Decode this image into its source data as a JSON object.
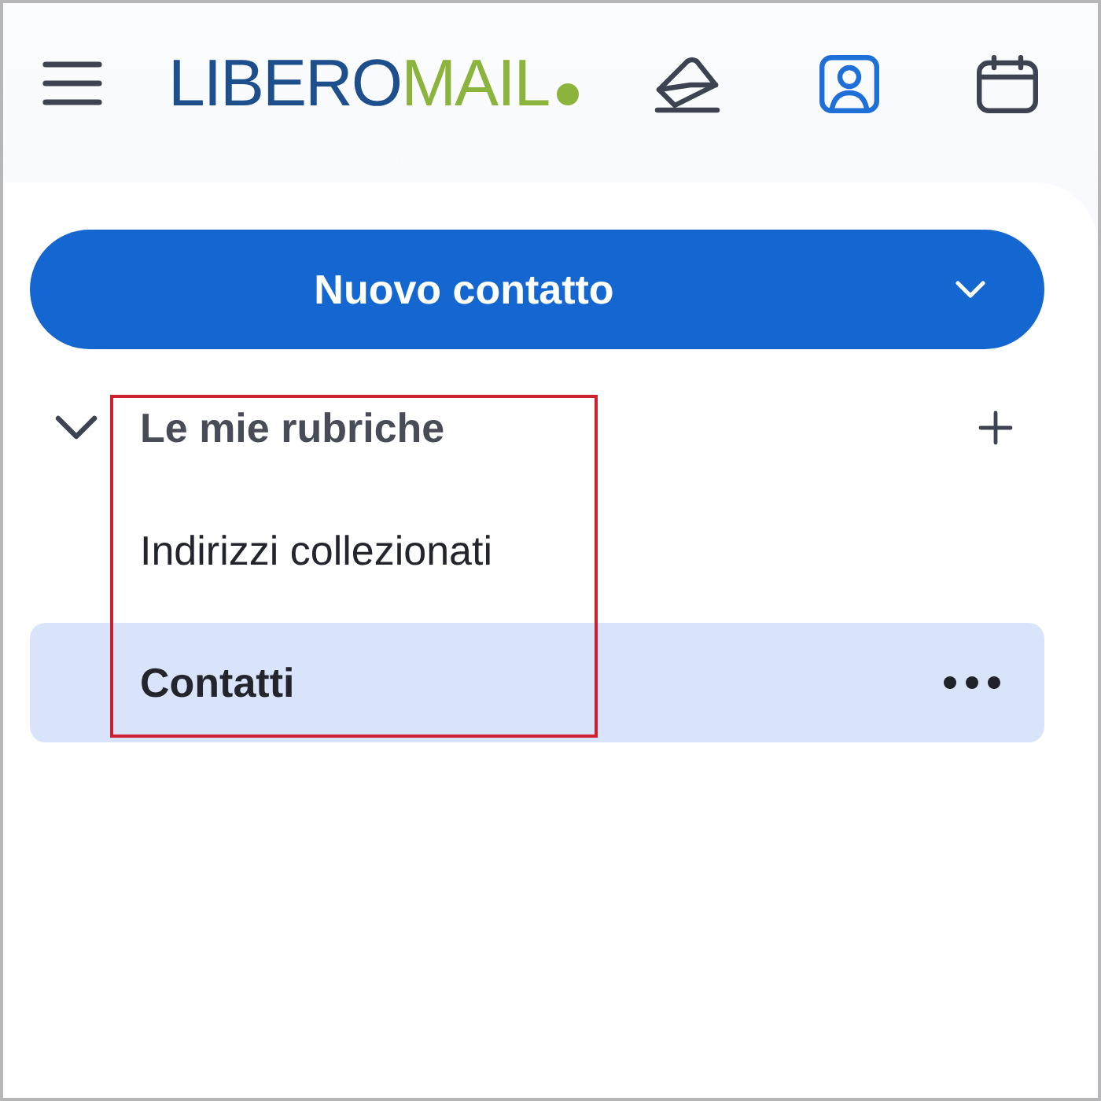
{
  "logo": {
    "primary": "LIBERO",
    "secondary": "MAIL"
  },
  "nav": [
    {
      "kind": "mail",
      "selected": false
    },
    {
      "kind": "contacts",
      "selected": true
    },
    {
      "kind": "calendar",
      "selected": false
    }
  ],
  "new_contact_button": {
    "label": "Nuovo contatto"
  },
  "address_books": {
    "title": "Le mie rubriche",
    "expanded": true,
    "items": [
      {
        "label": "Indirizzi collezionati",
        "selected": false
      },
      {
        "label": "Contatti",
        "selected": true
      }
    ]
  },
  "annotations": [
    {
      "kind": "box"
    }
  ]
}
